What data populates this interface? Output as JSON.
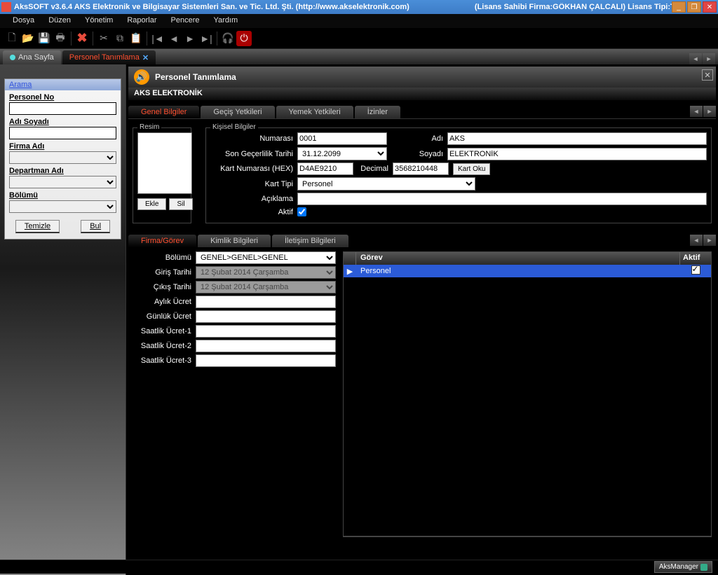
{
  "titlebar": {
    "app": "AksSOFT v3.6.4 AKS Elektronik ve Bilgisayar Sistemleri San. ve Tic. Ltd. Şti. (http://www.akselektronik.com)",
    "license": "(Lisans Sahibi Firma:GÖKHAN ÇALCALI)  Lisans Tipi:Tam Sürüm)"
  },
  "menubar": [
    "Dosya",
    "Düzen",
    "Yönetim",
    "Raporlar",
    "Pencere",
    "Yardım"
  ],
  "doctabs": {
    "inactive": "Ana Sayfa",
    "active": "Personel Tanımlama"
  },
  "search": {
    "title": "Arama",
    "fields": {
      "personel_no": "Personel No",
      "adi_soyadi": "Adı Soyadı",
      "firma_adi": "Firma Adı",
      "departman_adi": "Departman Adı",
      "bolumu": "Bölümü"
    },
    "btn_clear": "Temizle",
    "btn_find": "Bul"
  },
  "panel": {
    "title": "Personel Tanımlama",
    "firma": "AKS ELEKTRONİK"
  },
  "tabs1": [
    "Genel Bilgiler",
    "Geçiş Yetkileri",
    "Yemek Yetkileri",
    "İzinler"
  ],
  "resim": {
    "legend": "Resim",
    "btn_add": "Ekle",
    "btn_del": "Sil"
  },
  "kisisel": {
    "legend": "Kişisel Bilgiler",
    "labels": {
      "numarasi": "Numarası",
      "adi": "Adı",
      "soyadi": "Soyadı",
      "gecerlilik": "Son Geçerlilik Tarihi",
      "kart_hex": "Kart Numarası (HEX)",
      "decimal": "Decimal",
      "kart_oku": "Kart Oku",
      "kart_tipi": "Kart Tipi",
      "aciklama": "Açıklama",
      "aktif": "Aktif"
    },
    "values": {
      "numarasi": "0001",
      "adi": "AKS",
      "soyadi": "ELEKTRONİK",
      "gecerlilik": "31.12.2099",
      "kart_hex": "D4AE9210",
      "decimal": "3568210448",
      "kart_tipi": "Personel",
      "aciklama": ""
    }
  },
  "tabs2": [
    "Firma/Görev",
    "Kimlik Bilgileri",
    "İletişim Bilgileri"
  ],
  "firma_gorev": {
    "labels": {
      "bolumu": "Bölümü",
      "giris": "Giriş Tarihi",
      "cikis": "Çıkış Tarihi",
      "aylik": "Aylık Ücret",
      "gunluk": "Günlük Ücret",
      "saatlik1": "Saatlik Ücret-1",
      "saatlik2": "Saatlik Ücret-2",
      "saatlik3": "Saatlik Ücret-3"
    },
    "values": {
      "bolumu": "GENEL>GENEL>GENEL",
      "giris": "12  Şubat   2014 Çarşamba",
      "cikis": "12  Şubat   2014 Çarşamba"
    }
  },
  "grid": {
    "col_gorev": "Görev",
    "col_aktif": "Aktif",
    "row_gorev": "Personel"
  },
  "statusbar": {
    "text": "AksManager"
  }
}
